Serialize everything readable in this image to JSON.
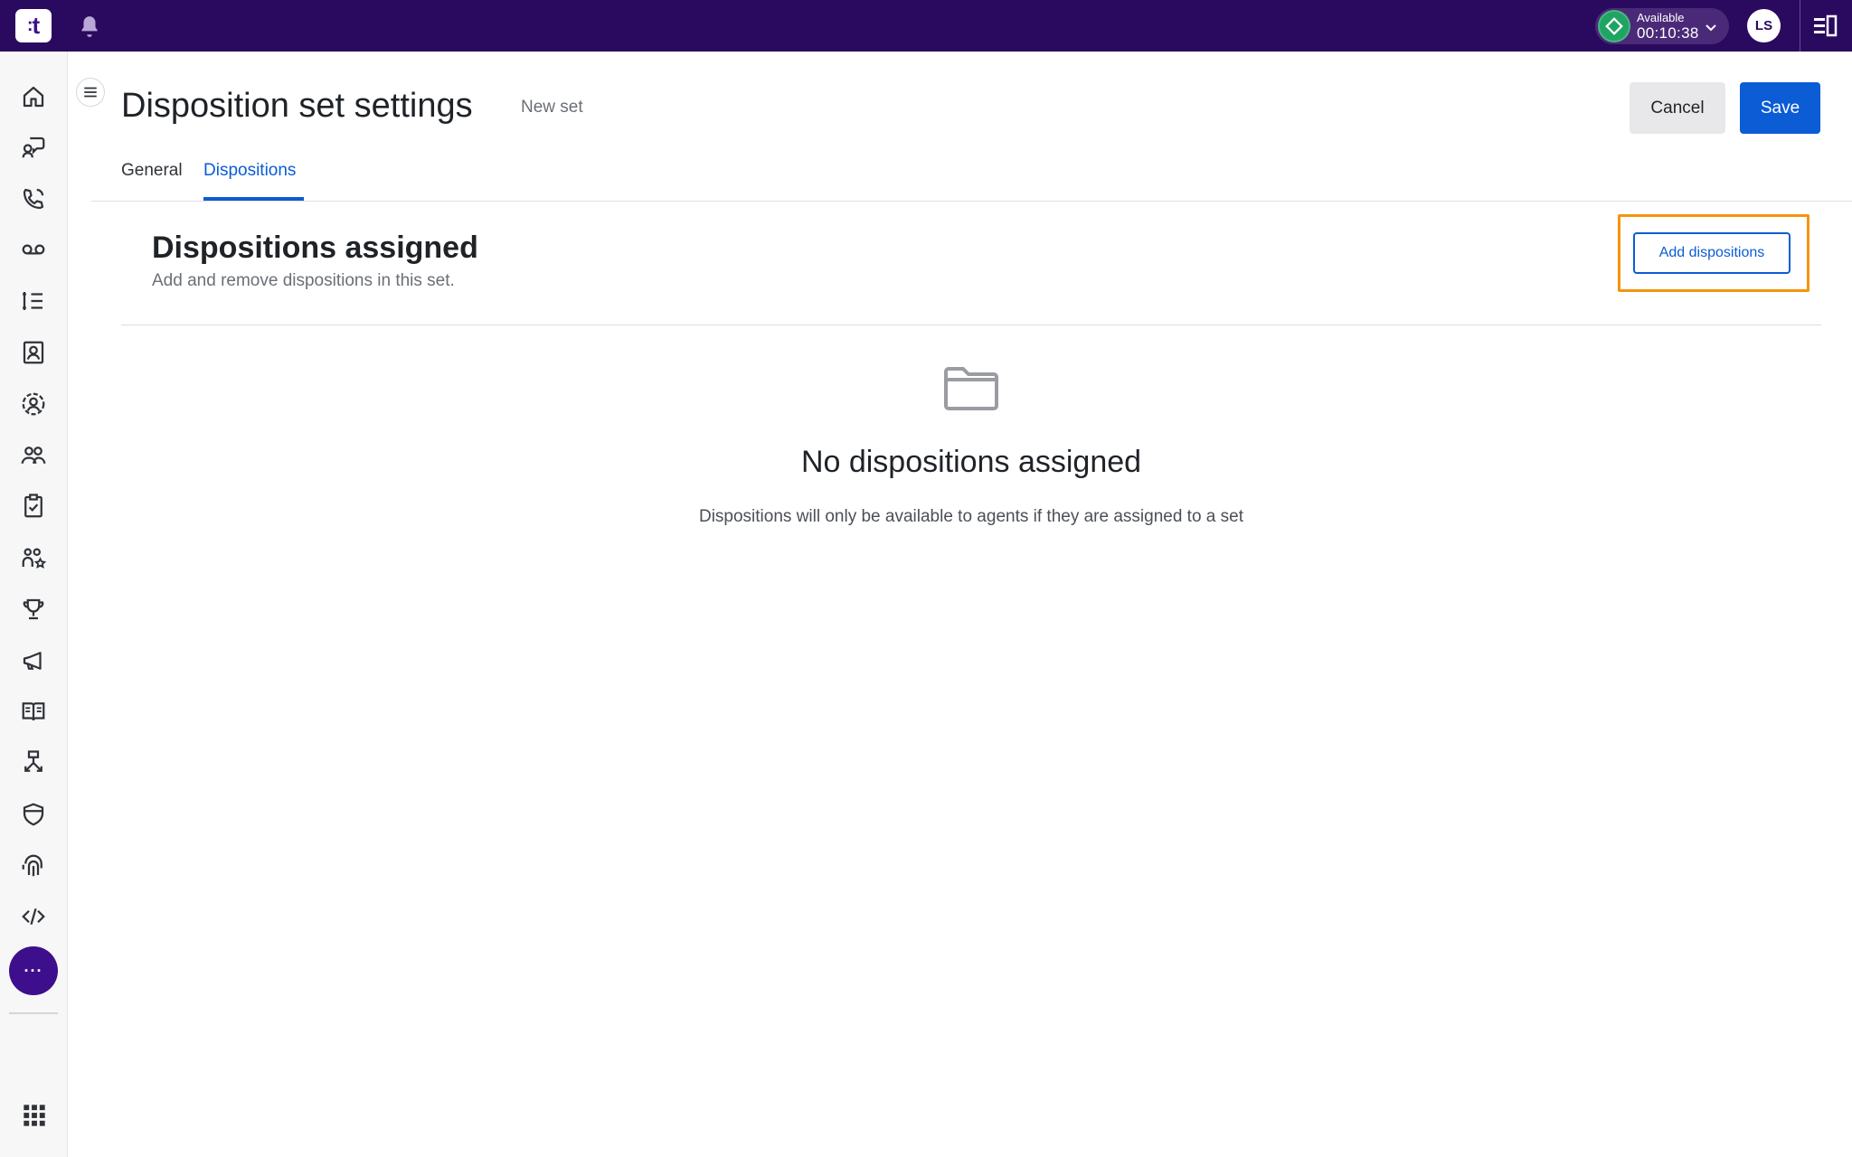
{
  "app": {
    "logo_text": "t"
  },
  "status": {
    "label": "Available",
    "timer": "00:10:38",
    "color": "#1fa463"
  },
  "user": {
    "initials": "LS"
  },
  "nav": {
    "icons": [
      "home-icon",
      "conversations-icon",
      "phone-icon",
      "voicemail-icon",
      "queue-list-icon",
      "contacts-book-icon",
      "user-circle-icon",
      "team-icon",
      "clipboard-check-icon",
      "people-star-icon",
      "trophy-icon",
      "megaphone-icon",
      "knowledge-book-icon",
      "routing-icon",
      "shield-icon",
      "fingerprint-icon",
      "code-icon"
    ],
    "more_label": "···"
  },
  "header": {
    "title": "Disposition set settings",
    "subtitle": "New set",
    "cancel_label": "Cancel",
    "save_label": "Save"
  },
  "tabs": [
    {
      "label": "General",
      "active": false
    },
    {
      "label": "Dispositions",
      "active": true
    }
  ],
  "section": {
    "title": "Dispositions assigned",
    "description": "Add and remove dispositions in this set.",
    "add_button_label": "Add dispositions"
  },
  "empty_state": {
    "title": "No dispositions assigned",
    "description": "Dispositions will only be available to agents if they are assigned to a set"
  },
  "colors": {
    "topbar": "#2a0a5e",
    "accent": "#0b5cd5",
    "highlight": "#f5940c"
  }
}
